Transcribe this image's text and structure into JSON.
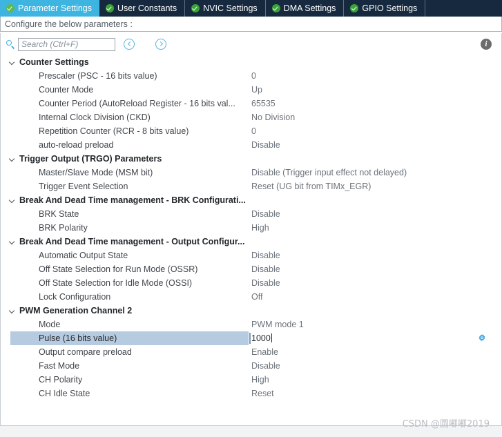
{
  "tabs": [
    {
      "label": "Parameter Settings",
      "icon": "check-circle-icon",
      "active": true
    },
    {
      "label": "User Constants",
      "icon": "check-circle-icon",
      "active": false
    },
    {
      "label": "NVIC Settings",
      "icon": "check-circle-icon",
      "active": false
    },
    {
      "label": "DMA Settings",
      "icon": "check-circle-icon",
      "active": false
    },
    {
      "label": "GPIO Settings",
      "icon": "check-circle-icon",
      "active": false
    }
  ],
  "header": {
    "instruction": "Configure the below parameters :"
  },
  "toolbar": {
    "search_placeholder": "Search (Ctrl+F)",
    "search_value": "",
    "back_icon": "chevron-left-circle-icon",
    "forward_icon": "chevron-right-circle-icon",
    "info_icon": "info-icon",
    "info_glyph": "i"
  },
  "tree": {
    "groups": [
      {
        "label": "Counter Settings",
        "expanded": true,
        "items": [
          {
            "label": "Prescaler (PSC - 16 bits value)",
            "value": "0"
          },
          {
            "label": "Counter Mode",
            "value": "Up"
          },
          {
            "label": "Counter Period (AutoReload Register - 16 bits val...",
            "value": "65535"
          },
          {
            "label": "Internal Clock Division (CKD)",
            "value": "No Division"
          },
          {
            "label": "Repetition Counter (RCR - 8 bits value)",
            "value": "0"
          },
          {
            "label": "auto-reload preload",
            "value": "Disable"
          }
        ]
      },
      {
        "label": "Trigger Output (TRGO) Parameters",
        "expanded": true,
        "items": [
          {
            "label": "Master/Slave Mode (MSM bit)",
            "value": "Disable (Trigger input effect not delayed)"
          },
          {
            "label": "Trigger Event Selection",
            "value": "Reset (UG bit from TIMx_EGR)"
          }
        ]
      },
      {
        "label": "Break And Dead Time management - BRK Configurati...",
        "expanded": true,
        "items": [
          {
            "label": "BRK State",
            "value": "Disable"
          },
          {
            "label": "BRK Polarity",
            "value": "High"
          }
        ]
      },
      {
        "label": "Break And Dead Time management - Output Configur...",
        "expanded": true,
        "items": [
          {
            "label": "Automatic Output State",
            "value": "Disable"
          },
          {
            "label": "Off State Selection for Run Mode (OSSR)",
            "value": "Disable"
          },
          {
            "label": "Off State Selection for Idle Mode (OSSI)",
            "value": "Disable"
          },
          {
            "label": "Lock Configuration",
            "value": "Off"
          }
        ]
      },
      {
        "label": "PWM Generation Channel 2",
        "expanded": true,
        "items": [
          {
            "label": "Mode",
            "value": "PWM mode 1"
          },
          {
            "label": "Pulse (16 bits value)",
            "value": "1000",
            "selected": true,
            "editing": true,
            "gear_icon": "gear-icon"
          },
          {
            "label": "Output compare preload",
            "value": "Enable"
          },
          {
            "label": "Fast Mode",
            "value": "Disable"
          },
          {
            "label": "CH Polarity",
            "value": "High"
          },
          {
            "label": "CH Idle State",
            "value": "Reset"
          }
        ]
      }
    ]
  },
  "watermark": {
    "text": "CSDN @圆嘟嘟2019"
  },
  "colors": {
    "tab_active_bg": "#3db5e0",
    "tab_inactive_bg": "#16293f",
    "check_green": "#3aa337",
    "accent_blue": "#4fb7e3",
    "selection_blue": "#b6cbe0",
    "gear_blue": "#49a8e0"
  }
}
